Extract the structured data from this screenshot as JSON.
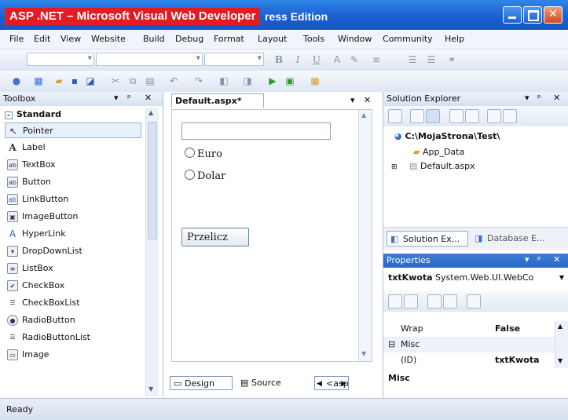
{
  "title": {
    "caption": "ASP .NET – Microsoft Visual Web Developer",
    "window_title_visible": "ress Edition"
  },
  "menu": [
    "File",
    "Edit",
    "View",
    "Website",
    "Build",
    "Debug",
    "Format",
    "Layout",
    "Tools",
    "Window",
    "Community",
    "Help"
  ],
  "format_toolbar": {
    "bold": "B",
    "italic": "I",
    "underline": "U"
  },
  "toolbox": {
    "title": "Toolbox",
    "category": "Standard",
    "items": [
      {
        "label": "Pointer",
        "icon": "pointer-icon",
        "glyph": "↖"
      },
      {
        "label": "Label",
        "icon": "label-icon",
        "glyph": "A"
      },
      {
        "label": "TextBox",
        "icon": "textbox-icon",
        "glyph": "ab"
      },
      {
        "label": "Button",
        "icon": "button-icon",
        "glyph": "ab"
      },
      {
        "label": "LinkButton",
        "icon": "linkbutton-icon",
        "glyph": "ab"
      },
      {
        "label": "ImageButton",
        "icon": "imagebutton-icon",
        "glyph": "▣"
      },
      {
        "label": "HyperLink",
        "icon": "hyperlink-icon",
        "glyph": "A"
      },
      {
        "label": "DropDownList",
        "icon": "dropdownlist-icon",
        "glyph": "▾"
      },
      {
        "label": "ListBox",
        "icon": "listbox-icon",
        "glyph": "≡"
      },
      {
        "label": "CheckBox",
        "icon": "checkbox-icon",
        "glyph": "✔"
      },
      {
        "label": "CheckBoxList",
        "icon": "checkboxlist-icon",
        "glyph": "☰"
      },
      {
        "label": "RadioButton",
        "icon": "radiobutton-icon",
        "glyph": "◉"
      },
      {
        "label": "RadioButtonList",
        "icon": "radiobuttonlist-icon",
        "glyph": "☰"
      },
      {
        "label": "Image",
        "icon": "image-icon",
        "glyph": "▭"
      }
    ]
  },
  "editor": {
    "tab_label": "Default.aspx*",
    "radio1": "Euro",
    "radio2": "Dolar",
    "button_label": "Przelicz",
    "view_design": "Design",
    "view_source": "Source",
    "tag_nav": "<asp"
  },
  "solution_explorer": {
    "title": "Solution Explorer",
    "root": "C:\\MojaStrona\\Test\\",
    "items": [
      "App_Data",
      "Default.aspx"
    ],
    "tabs": [
      "Solution Ex...",
      "Database E..."
    ]
  },
  "properties": {
    "title": "Properties",
    "object_name": "txtKwota",
    "object_type": "System.Web.UI.WebCo",
    "rows": [
      {
        "name": "Wrap",
        "value": "False"
      },
      {
        "name": "Misc",
        "value": "",
        "category": true
      },
      {
        "name": "(ID)",
        "value": "txtKwota"
      }
    ],
    "description_title": "Misc"
  },
  "status": "Ready",
  "colors": {
    "titlebar": "#1b5fd0",
    "caption_red": "#e31b23",
    "selection": "#e8f0fc"
  }
}
